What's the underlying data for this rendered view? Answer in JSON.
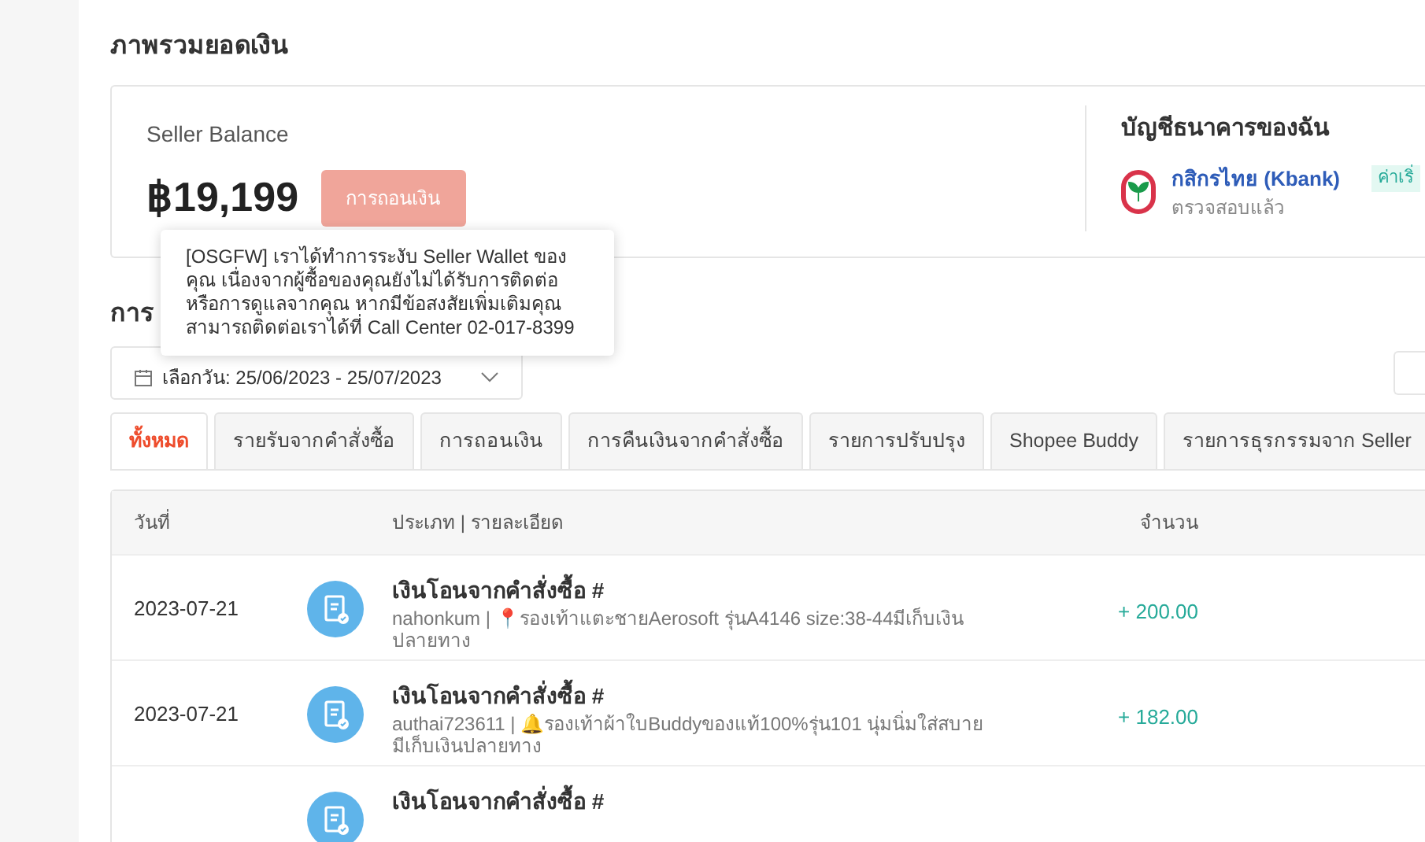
{
  "title": "ภาพรวมยอดเงิน",
  "balance": {
    "label": "Seller Balance",
    "amount": "฿19,199",
    "withdraw_button": {
      "label": "การถอนเงิน",
      "disabled": true
    }
  },
  "tooltip": "[OSGFW] เราได้ทำการระงับ Seller Wallet ของคุณ เนื่องจากผู้ซื้อของคุณยังไม่ได้รับการติดต่อหรือการดูแลจากคุณ หากมีข้อสงสัยเพิ่มเติมคุณสามารถติดต่อเราได้ที่ Call Center 02-017-8399",
  "bank": {
    "title": "บัญชีธนาคารของฉัน",
    "name": "กสิกรไทย (Kbank)",
    "status": "ตรวจสอบแล้ว",
    "tag": "ค่าเริ่"
  },
  "transactions_title": "การ",
  "date_filter": "เลือกวัน: 25/06/2023 - 25/07/2023",
  "tabs": [
    {
      "label": "ทั้งหมด",
      "selected": true
    },
    {
      "label": "รายรับจากคำสั่งซื้อ",
      "selected": false
    },
    {
      "label": "การถอนเงิน",
      "selected": false
    },
    {
      "label": "การคืนเงินจากคำสั่งซื้อ",
      "selected": false
    },
    {
      "label": "รายการปรับปรุง",
      "selected": false
    },
    {
      "label": "Shopee Buddy",
      "selected": false
    },
    {
      "label": "รายการธุรกรรมจาก Seller",
      "selected": false
    }
  ],
  "table": {
    "columns": [
      "วันที่",
      "ประเภท | รายละเอียด",
      "จำนวน"
    ],
    "rows": [
      {
        "date": "2023-07-21",
        "title": "เงินโอนจากคำสั่งซื้อ #",
        "detail": "nahonkum | 📍รองเท้าแตะชายAerosoft รุ่นA4146 size:38-44มีเก็บเงินปลายทาง",
        "amount": "+ 200.00"
      },
      {
        "date": "2023-07-21",
        "title": "เงินโอนจากคำสั่งซื้อ #",
        "detail": "authai723611 | 🔔รองเท้าผ้าใบBuddyของแท้100%รุ่น101 นุ่มนิ่มใส่สบายมีเก็บเงินปลายทาง",
        "amount": "+ 182.00"
      },
      {
        "date": "",
        "title": "เงินโอนจากคำสั่งซื้อ #",
        "detail": "",
        "amount": ""
      }
    ]
  }
}
